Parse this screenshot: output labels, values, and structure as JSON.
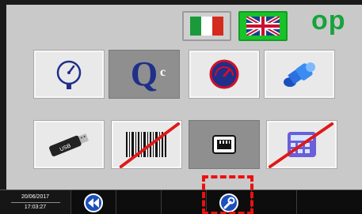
{
  "brand": {
    "text": "op"
  },
  "languages": [
    {
      "name": "italian-flag",
      "active": false
    },
    {
      "name": "uk-flag",
      "active": true
    }
  ],
  "tiles": {
    "row1": [
      "gauge-icon",
      "qc-icon",
      "tachometer-icon",
      "fitting-icon"
    ],
    "row2": [
      "usb-stick-icon",
      "barcode-icon",
      "network-port-icon",
      "keypad-icon"
    ],
    "selected": [
      "qc-icon",
      "network-port-icon"
    ],
    "disabled": [
      "barcode-icon",
      "keypad-icon"
    ]
  },
  "qc_tile": {
    "main": "Q",
    "superscript": "c"
  },
  "status_bar": {
    "date": "20/06/2017",
    "time": "17:03:27"
  },
  "colors": {
    "accent_green": "#18c32a",
    "brand_green": "#17a33b",
    "button_blue": "#1b4fbd",
    "highlight_red": "#ee0f0f"
  }
}
